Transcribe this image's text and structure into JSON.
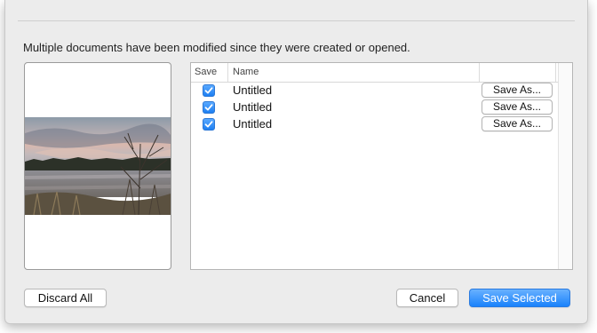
{
  "dialog": {
    "message": "Multiple documents have been modified since they were created or opened."
  },
  "table": {
    "headers": {
      "save": "Save",
      "name": "Name",
      "action": ""
    },
    "rows": [
      {
        "name": "Untitled",
        "checked": true,
        "action_label": "Save As..."
      },
      {
        "name": "Untitled",
        "checked": true,
        "action_label": "Save As..."
      },
      {
        "name": "Untitled",
        "checked": true,
        "action_label": "Save As..."
      }
    ]
  },
  "buttons": {
    "discard_all": "Discard All",
    "cancel": "Cancel",
    "save_selected": "Save Selected"
  },
  "colors": {
    "accent": "#1a82fb",
    "dialog_bg": "#ececec"
  },
  "icons": {
    "checkbox": "checkmark-icon",
    "preview": "landscape-photo"
  }
}
